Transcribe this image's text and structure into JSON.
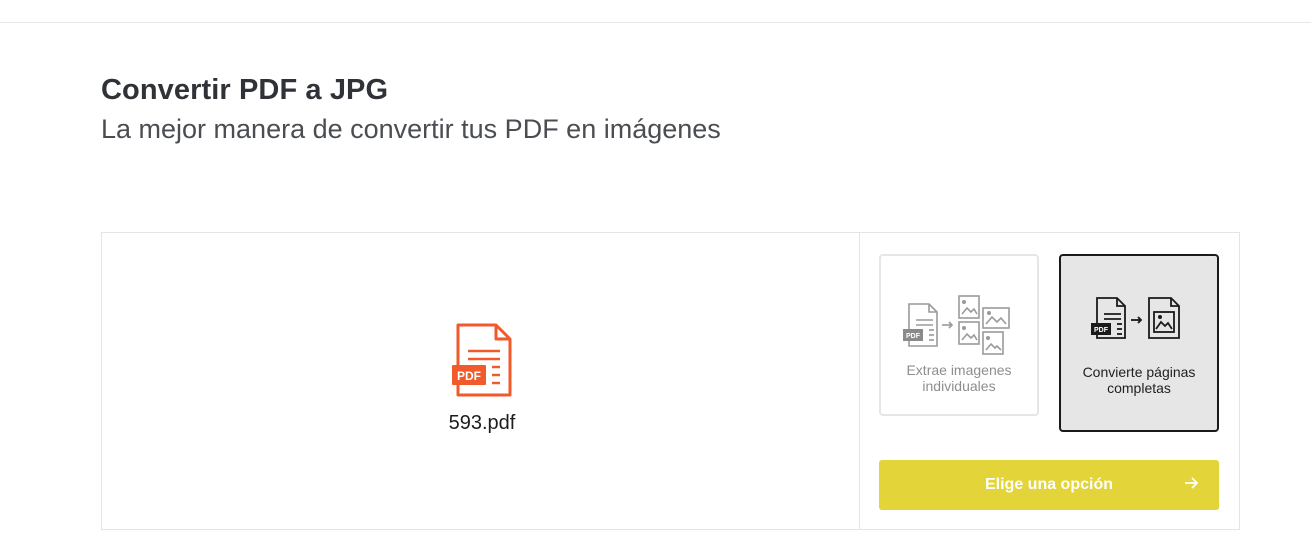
{
  "header": {
    "title": "Convertir PDF a JPG",
    "subtitle": "La mejor manera de convertir tus PDF en imágenes"
  },
  "file": {
    "name": "593.pdf",
    "icon": "pdf-file-icon",
    "icon_color": "#f15a2b",
    "badge": "PDF"
  },
  "options": [
    {
      "label": "Extrae imagenes individuales",
      "icon": "extract-images-icon",
      "selected": false,
      "badge": "PDF"
    },
    {
      "label": "Convierte páginas completas",
      "icon": "convert-pages-icon",
      "selected": true,
      "badge": "PDF"
    }
  ],
  "action": {
    "label": "Elige una opción",
    "icon": "arrow-right-icon",
    "color": "#e3d439"
  }
}
